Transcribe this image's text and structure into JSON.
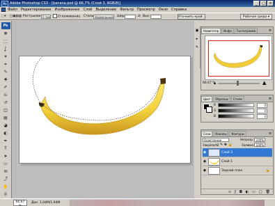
{
  "window": {
    "title": "Adobe Photoshop CS3 - [banana.psd @ 66,7% (Слой 3, RGB/8)]",
    "controls": [
      "_",
      "□",
      "×"
    ]
  },
  "menu": [
    "Файл",
    "Редактирование",
    "Изображение",
    "Слой",
    "Выделение",
    "Фильтр",
    "Просмотр",
    "Окно",
    "Справка"
  ],
  "options": {
    "feather_label": "Растушевка:",
    "feather_value": "0 пикс",
    "antialias_label": "Сглаживание",
    "style_label": "Стиль:",
    "style_value": "Нормальный",
    "width_label": "Шир:",
    "height_label": "Выс:",
    "refine_button": "Уточнить край...",
    "workspace_button": "Рабочая среда ▾"
  },
  "toolbox": {
    "logo": "Ps",
    "tools": [
      "move-icon",
      "marquee-icon",
      "lasso-icon",
      "magic-wand-icon",
      "crop-icon",
      "slice-icon",
      "healing-icon",
      "brush-icon",
      "stamp-icon",
      "history-brush-icon",
      "eraser-icon",
      "gradient-icon",
      "blur-icon",
      "dodge-icon",
      "pen-icon",
      "type-icon",
      "path-select-icon",
      "shape-icon",
      "notes-icon",
      "eyedropper-icon",
      "hand-icon",
      "zoom-icon"
    ],
    "glyphs": [
      "✥",
      "⬚",
      "ʆ",
      "✶",
      "⌗",
      "✎",
      "✚",
      "✐",
      "⎌",
      "↺",
      "◫",
      "▤",
      "◕",
      "◐",
      "✒",
      "T",
      "➤",
      "▭",
      "✉",
      "⤴",
      "✋",
      "⚲"
    ],
    "foreground_color": "#000000",
    "background_color": "#ffffff"
  },
  "navigator": {
    "tabs": [
      "Навигатор",
      "Инфо",
      "Гистограмма"
    ],
    "zoom": "66,67 %"
  },
  "color_panel": {
    "tabs": [
      "Цвет",
      "Образцы",
      "Стили"
    ],
    "channels": [
      {
        "label": "R",
        "value": "0"
      },
      {
        "label": "G",
        "value": "0"
      },
      {
        "label": "B",
        "value": "0"
      }
    ]
  },
  "layers_panel": {
    "tabs": [
      "Слои",
      "Каналы",
      "Контуры"
    ],
    "blend_mode": "Осветление",
    "opacity_label": "Непрозр.:",
    "opacity_value": "100%",
    "lock_label": "Закрепить:",
    "fill_label": "Заливка:",
    "fill_value": "100%",
    "layers": [
      {
        "name": "Слой 3",
        "selected": true,
        "locked": false
      },
      {
        "name": "Слой 1",
        "selected": false,
        "locked": false
      },
      {
        "name": "Задний план",
        "selected": false,
        "locked": true
      }
    ]
  },
  "status": {
    "zoom": "66,67 %",
    "doc": "Док: 1,04М/1,04М"
  },
  "colors": {
    "banana_light": "#f6e04a",
    "banana_dark": "#d6a823",
    "selection_layer": "#3178d4"
  }
}
